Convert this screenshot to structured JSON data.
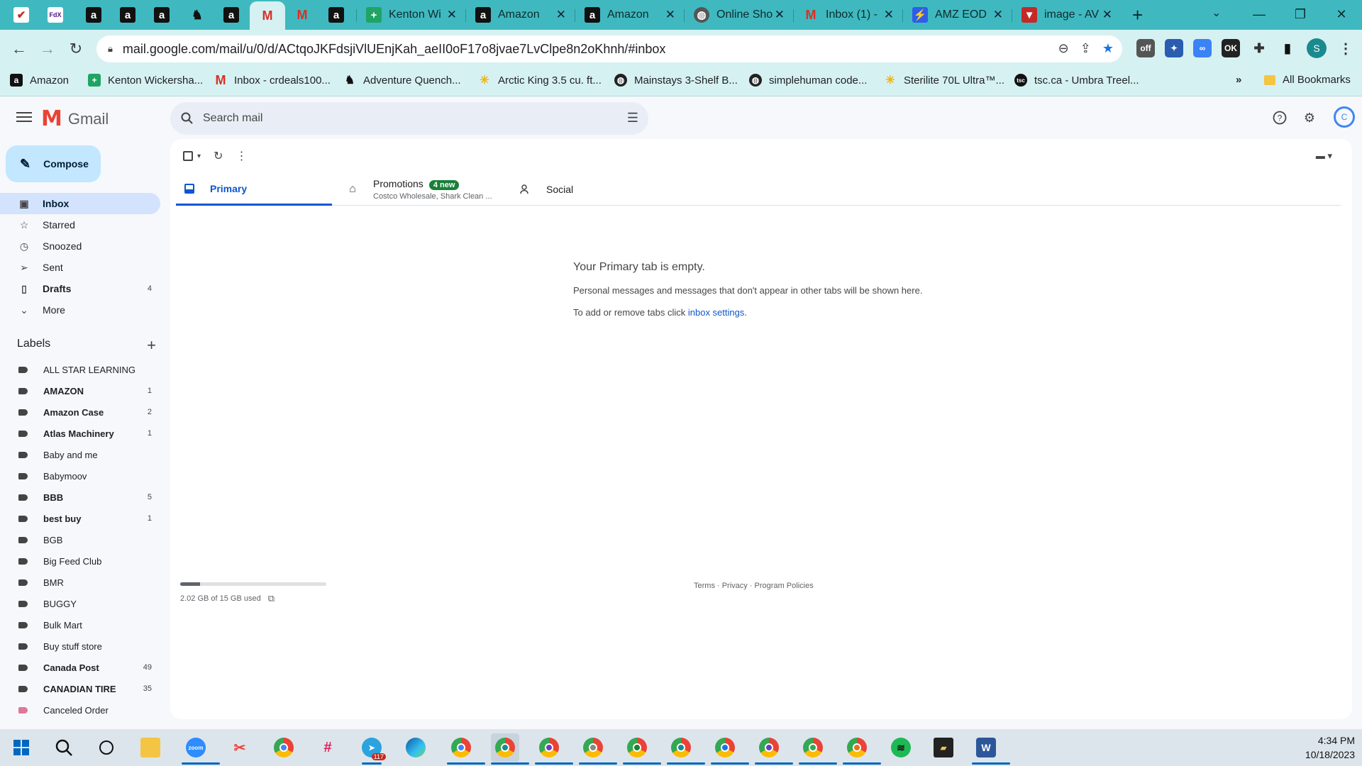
{
  "browser": {
    "tabs": [
      {
        "icon": "checkmark-icon",
        "title": ""
      },
      {
        "icon": "fedex-icon",
        "title": ""
      },
      {
        "icon": "amazon-icon",
        "title": ""
      },
      {
        "icon": "amazon-icon",
        "title": ""
      },
      {
        "icon": "amazon-icon",
        "title": ""
      },
      {
        "icon": "dog-icon",
        "title": ""
      },
      {
        "icon": "amazon-icon",
        "title": ""
      },
      {
        "icon": "gmail-icon",
        "title": ""
      },
      {
        "icon": "gmail-icon",
        "title": ""
      },
      {
        "icon": "amazon-icon",
        "title": ""
      },
      {
        "icon": "sheets-icon",
        "title": "Kenton Wi"
      },
      {
        "icon": "amazon-icon",
        "title": "Amazon"
      },
      {
        "icon": "amazon-icon",
        "title": "Amazon"
      },
      {
        "icon": "globe-icon",
        "title": "Online Sho"
      },
      {
        "icon": "gmail-icon",
        "title": "Inbox (1) -"
      },
      {
        "icon": "amz-eod-icon",
        "title": "AMZ EOD"
      },
      {
        "icon": "image-icon",
        "title": "image - AV"
      }
    ],
    "url": "mail.google.com/mail/u/0/d/ACtqoJKFdsjiVlUEnjKah_aeII0oF17o8jvae7LvClpe8n2oKhnh/#inbox",
    "bookmarks": [
      {
        "icon": "amazon-icon",
        "label": "Amazon"
      },
      {
        "icon": "sheets-icon",
        "label": "Kenton Wickersha..."
      },
      {
        "icon": "gmail-icon",
        "label": "Inbox - crdeals100..."
      },
      {
        "icon": "dog-icon",
        "label": "Adventure Quench..."
      },
      {
        "icon": "walmart-icon",
        "label": "Arctic King 3.5 cu. ft..."
      },
      {
        "icon": "globe-icon",
        "label": "Mainstays 3-Shelf B..."
      },
      {
        "icon": "globe-icon",
        "label": "simplehuman code..."
      },
      {
        "icon": "walmart-icon",
        "label": "Sterilite 70L Ultra™..."
      },
      {
        "icon": "tsc-icon",
        "label": "tsc.ca - Umbra Treel..."
      }
    ],
    "all_bookmarks": "All Bookmarks",
    "profile_initial": "S"
  },
  "gmail": {
    "brand": "Gmail",
    "search_placeholder": "Search mail",
    "compose": "Compose",
    "nav": [
      {
        "icon": "inbox-icon",
        "label": "Inbox",
        "count": "",
        "active": true,
        "bold": true
      },
      {
        "icon": "star-icon",
        "label": "Starred",
        "count": "",
        "active": false,
        "bold": false
      },
      {
        "icon": "clock-icon",
        "label": "Snoozed",
        "count": "",
        "active": false,
        "bold": false
      },
      {
        "icon": "send-icon",
        "label": "Sent",
        "count": "",
        "active": false,
        "bold": false
      },
      {
        "icon": "draft-icon",
        "label": "Drafts",
        "count": "4",
        "active": false,
        "bold": true
      },
      {
        "icon": "chevron-down-icon",
        "label": "More",
        "count": "",
        "active": false,
        "bold": false
      }
    ],
    "labels_title": "Labels",
    "labels": [
      {
        "name": "ALL STAR LEARNING",
        "count": "",
        "bold": false,
        "color": "#444444"
      },
      {
        "name": "AMAZON",
        "count": "1",
        "bold": true,
        "color": "#444444"
      },
      {
        "name": "Amazon Case",
        "count": "2",
        "bold": true,
        "color": "#444444"
      },
      {
        "name": "Atlas Machinery",
        "count": "1",
        "bold": true,
        "color": "#444444"
      },
      {
        "name": "Baby and me",
        "count": "",
        "bold": false,
        "color": "#444444"
      },
      {
        "name": "Babymoov",
        "count": "",
        "bold": false,
        "color": "#444444"
      },
      {
        "name": "BBB",
        "count": "5",
        "bold": true,
        "color": "#444444"
      },
      {
        "name": "best buy",
        "count": "1",
        "bold": true,
        "color": "#444444"
      },
      {
        "name": "BGB",
        "count": "",
        "bold": false,
        "color": "#444444"
      },
      {
        "name": "Big Feed Club",
        "count": "",
        "bold": false,
        "color": "#444444"
      },
      {
        "name": "BMR",
        "count": "",
        "bold": false,
        "color": "#444444"
      },
      {
        "name": "BUGGY",
        "count": "",
        "bold": false,
        "color": "#444444"
      },
      {
        "name": "Bulk Mart",
        "count": "",
        "bold": false,
        "color": "#444444"
      },
      {
        "name": "Buy stuff store",
        "count": "",
        "bold": false,
        "color": "#444444"
      },
      {
        "name": "Canada Post",
        "count": "49",
        "bold": true,
        "color": "#444444"
      },
      {
        "name": "CANADIAN TIRE",
        "count": "35",
        "bold": true,
        "color": "#444444"
      },
      {
        "name": "Canceled Order",
        "count": "",
        "bold": false,
        "color": "#e07798"
      }
    ],
    "tabs": {
      "primary": "Primary",
      "promotions": "Promotions",
      "promotions_badge": "4 new",
      "promotions_sub": "Costco Wholesale, Shark Clean ...",
      "social": "Social"
    },
    "empty": {
      "heading": "Your Primary tab is empty.",
      "line1": "Personal messages and messages that don't appear in other tabs will be shown here.",
      "line2_prefix": "To add or remove tabs click ",
      "line2_link": "inbox settings",
      "line2_suffix": "."
    },
    "storage": {
      "text": "2.02 GB of 15 GB used",
      "fraction": 0.135
    },
    "footer": "Terms · Privacy · Program Policies"
  },
  "taskbar": {
    "time": "4:34 PM",
    "date": "10/18/2023",
    "apps": [
      "windows-icon",
      "search-icon",
      "task-view-icon",
      "file-explorer-icon",
      "zoom-icon",
      "snipping-icon",
      "chrome-icon",
      "slack-icon",
      "telegram-icon",
      "edge-icon",
      "chrome-profile-icon",
      "chrome-profile-icon",
      "chrome-profile-icon",
      "chrome-profile-icon",
      "chrome-profile-icon",
      "chrome-profile-icon",
      "chrome-profile-icon",
      "chrome-profile-icon",
      "chrome-profile-icon",
      "chrome-profile-icon",
      "spotify-icon",
      "sticky-notes-icon",
      "word-icon"
    ],
    "telegram_badge": "117"
  },
  "colors": {
    "tabstrip": "#3fb9bf",
    "toolbar": "#d6f1f2",
    "accent": "#0b57d0",
    "compose": "#c2e7ff",
    "nav_active": "#d3e3fd"
  }
}
